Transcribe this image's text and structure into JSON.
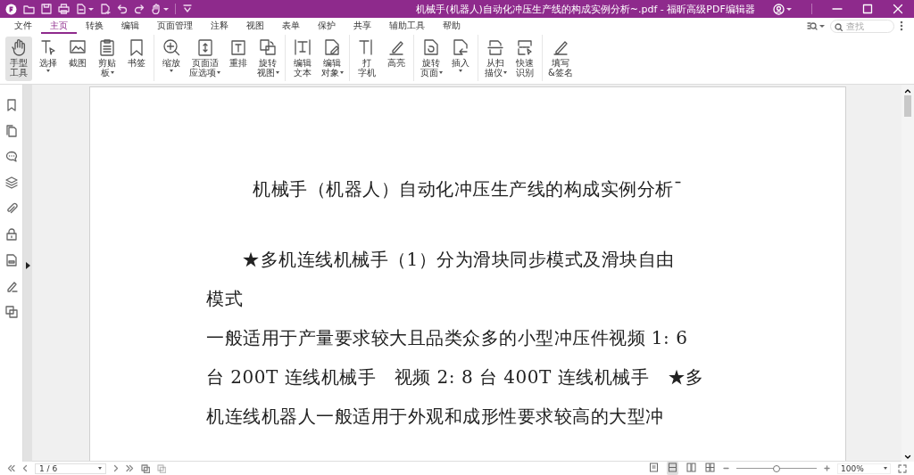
{
  "window": {
    "title": "机械手(机器人)自动化冲压生产线的构成实例分析~.pdf - 福昕高级PDF编辑器"
  },
  "menu": [
    {
      "label": "文件",
      "selected": false
    },
    {
      "label": "主页",
      "selected": true
    },
    {
      "label": "转换",
      "selected": false
    },
    {
      "label": "编辑",
      "selected": false
    },
    {
      "label": "页面管理",
      "selected": false
    },
    {
      "label": "注释",
      "selected": false
    },
    {
      "label": "视图",
      "selected": false
    },
    {
      "label": "表单",
      "selected": false
    },
    {
      "label": "保护",
      "selected": false
    },
    {
      "label": "共享",
      "selected": false
    },
    {
      "label": "辅助工具",
      "selected": false
    },
    {
      "label": "帮助",
      "selected": false
    }
  ],
  "search": {
    "placeholder": "查找"
  },
  "ribbon": [
    [
      {
        "lines": [
          "手型",
          "工具"
        ],
        "dropdown": false,
        "selected": true
      },
      {
        "lines": [
          "选择"
        ],
        "dropdown": true,
        "selected": false
      },
      {
        "lines": [
          "截图"
        ],
        "dropdown": false,
        "selected": false
      },
      {
        "lines": [
          "剪贴",
          "板"
        ],
        "dropdown": true,
        "selected": false
      },
      {
        "lines": [
          "书签"
        ],
        "dropdown": false,
        "selected": false
      }
    ],
    [
      {
        "lines": [
          "缩放"
        ],
        "dropdown": true,
        "selected": false
      },
      {
        "lines": [
          "页面适",
          "应选项"
        ],
        "dropdown": true,
        "selected": false
      },
      {
        "lines": [
          "重排"
        ],
        "dropdown": false,
        "selected": false
      },
      {
        "lines": [
          "旋转",
          "视图"
        ],
        "dropdown": true,
        "selected": false
      }
    ],
    [
      {
        "lines": [
          "编辑",
          "文本"
        ],
        "dropdown": false,
        "selected": false
      },
      {
        "lines": [
          "编辑",
          "对象"
        ],
        "dropdown": true,
        "selected": false
      }
    ],
    [
      {
        "lines": [
          "打",
          "字机"
        ],
        "dropdown": false,
        "selected": false
      },
      {
        "lines": [
          "高亮"
        ],
        "dropdown": false,
        "selected": false
      }
    ],
    [
      {
        "lines": [
          "旋转",
          "页面"
        ],
        "dropdown": true,
        "selected": false
      },
      {
        "lines": [
          "插入"
        ],
        "dropdown": true,
        "selected": false
      }
    ],
    [
      {
        "lines": [
          "从扫",
          "描仪"
        ],
        "dropdown": true,
        "selected": false
      },
      {
        "lines": [
          "快速",
          "识别"
        ],
        "dropdown": false,
        "selected": false
      }
    ],
    [
      {
        "lines": [
          "填写",
          "&签名"
        ],
        "dropdown": false,
        "selected": false
      }
    ]
  ],
  "document": {
    "lines": [
      {
        "kind": "title",
        "text": "机械手（机器人）自动化冲压生产线的构成实例分析¯"
      },
      {
        "kind": "indent",
        "text": "★多机连线机械手（1）分为滑块同步模式及滑块自由"
      },
      {
        "kind": "body",
        "text": "模式"
      },
      {
        "kind": "body",
        "text": "一般适用于产量要求较大且品类众多的小型冲压件视频 1: 6"
      },
      {
        "kind": "body",
        "text": "台 200T 连线机械手　视频 2: 8 台 400T 连线机械手　★多"
      },
      {
        "kind": "body",
        "text": "机连线机器人一般适用于外观和成形性要求较高的大型冲"
      }
    ]
  },
  "status_bar": {
    "page": "1 / 6",
    "zoom": "100%",
    "zoom_slider": {
      "level": 0.5
    },
    "views": [
      {
        "selected": false
      },
      {
        "selected": true
      },
      {
        "selected": false
      },
      {
        "selected": false
      }
    ]
  }
}
